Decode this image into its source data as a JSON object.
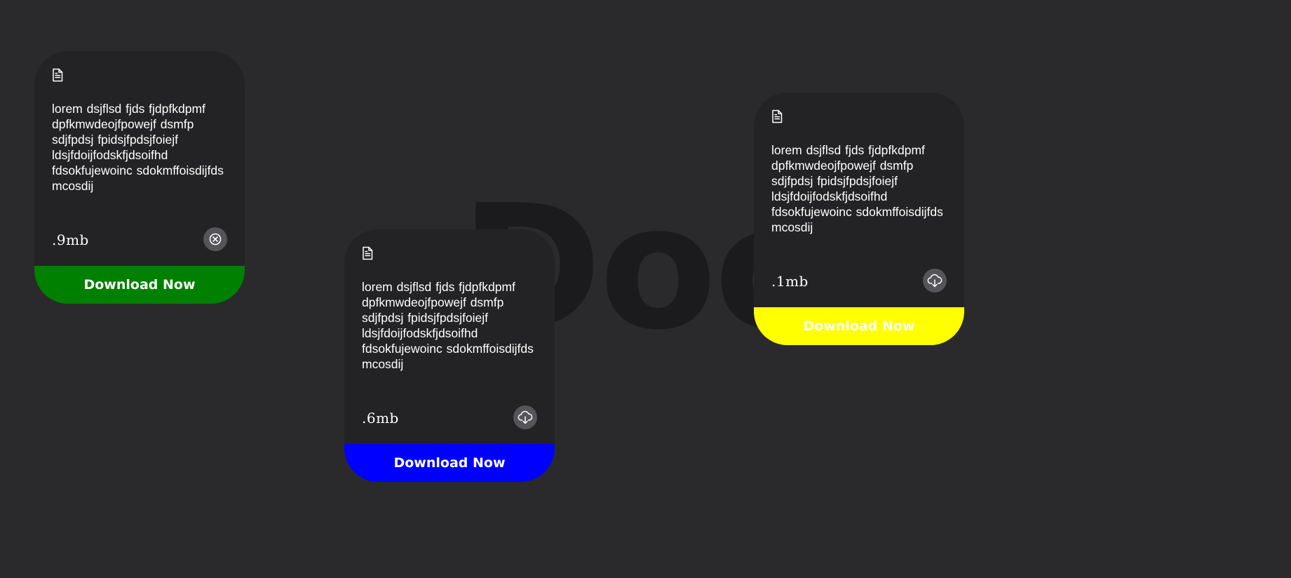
{
  "background_word": "Docs.",
  "colors": {
    "page_background": "#2a2a2c",
    "card_background": "#232325",
    "icon_circle": "#545459"
  },
  "cards": [
    {
      "doc_icon": "document-icon",
      "text": "lorem dsjflsd fjds fjdpfkdpmf dpfkmwdeojfpowejf dsmfp sdjfpdsj fpidsjfpdsjfoiejf ldsjfdoijfodskfjdsoifhd fdsokfujewoinc sdokmffoisdijfds mcosdij",
      "size": ".9mb",
      "action_icon": "cancel-icon",
      "button_label": "Download Now",
      "button_color": "#008000"
    },
    {
      "doc_icon": "document-icon",
      "text": "lorem dsjflsd fjds fjdpfkdpmf dpfkmwdeojfpowejf dsmfp sdjfpdsj fpidsjfpdsjfoiejf ldsjfdoijfodskfjdsoifhd fdsokfujewoinc sdokmffoisdijfds mcosdij",
      "size": ".6mb",
      "action_icon": "cloud-download-icon",
      "button_label": "Download Now",
      "button_color": "#0000ff"
    },
    {
      "doc_icon": "document-icon",
      "text": "lorem dsjflsd fjds fjdpfkdpmf dpfkmwdeojfpowejf dsmfp sdjfpdsj fpidsjfpdsjfoiejf ldsjfdoijfodskfjdsoifhd fdsokfujewoinc sdokmffoisdijfds mcosdij",
      "size": ".1mb",
      "action_icon": "cloud-download-icon",
      "button_label": "Download Now",
      "button_color": "#ffff00"
    }
  ]
}
